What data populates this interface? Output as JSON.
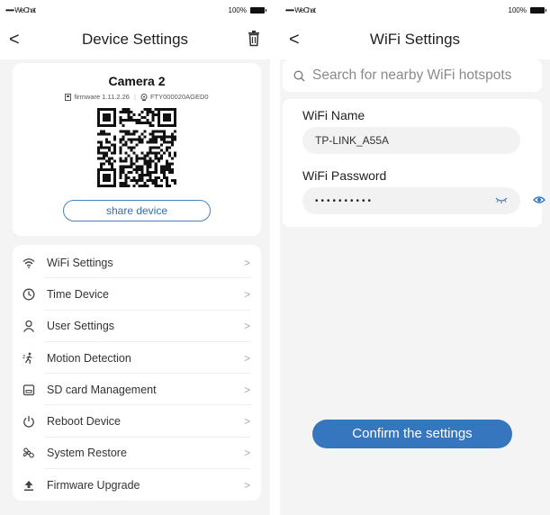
{
  "left": {
    "status": {
      "carrier": "••••• WeChat",
      "battery_pct": "100%"
    },
    "nav": {
      "back": "<",
      "title": "Device Settings"
    },
    "device": {
      "name": "Camera 2",
      "firmware": "firmware 1.11.2.26",
      "device_id": "FTY000020AGED0",
      "share_label": "share device"
    },
    "menu": [
      {
        "label": "WiFi Settings",
        "icon": "wifi-icon"
      },
      {
        "label": "Time Device",
        "icon": "clock-icon"
      },
      {
        "label": "User Settings",
        "icon": "user-icon"
      },
      {
        "label": "Motion Detection",
        "icon": "motion-icon"
      },
      {
        "label": "SD card Management",
        "icon": "sd-card-icon"
      },
      {
        "label": "Reboot Device",
        "icon": "power-icon"
      },
      {
        "label": "System Restore",
        "icon": "restore-icon"
      },
      {
        "label": "Firmware Upgrade",
        "icon": "upload-icon"
      }
    ],
    "chevron": ">"
  },
  "right": {
    "status": {
      "carrier": "••••• WeChat",
      "battery_pct": "100%"
    },
    "nav": {
      "back": "<",
      "title": "WiFi Settings"
    },
    "search": {
      "placeholder": "Search for nearby WiFi hotspots"
    },
    "wifi_name": {
      "label": "WiFi Name",
      "value": "TP-LINK_A55A"
    },
    "wifi_password": {
      "label": "WiFi Password",
      "value": "••••••••••"
    },
    "confirm_label": "Confirm the settings"
  },
  "colors": {
    "accent": "#3576bf",
    "background": "#f4f4f4"
  }
}
